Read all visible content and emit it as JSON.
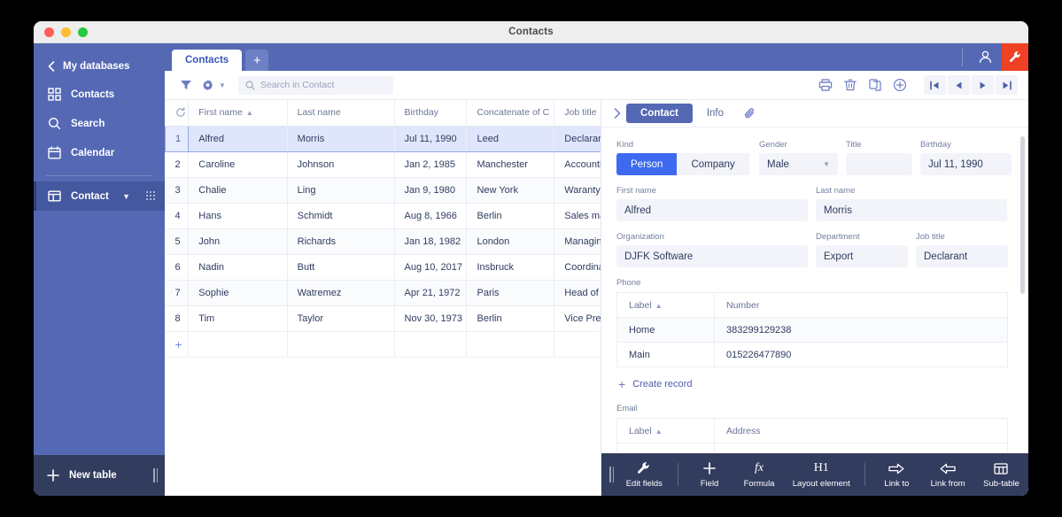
{
  "window": {
    "title": "Contacts"
  },
  "sidebar": {
    "back_label": "My databases",
    "items": [
      {
        "label": "Contacts",
        "icon": "grid-icon"
      },
      {
        "label": "Search",
        "icon": "search-icon"
      },
      {
        "label": "Calendar",
        "icon": "calendar-icon"
      }
    ],
    "active_table": {
      "label": "Contact",
      "icon": "table-icon"
    },
    "new_table_label": "New table"
  },
  "tabbar": {
    "tabs": [
      {
        "label": "Contacts"
      }
    ],
    "add_label": "+"
  },
  "toolbar": {
    "search_placeholder": "Search in Contact",
    "icons": [
      "filter-icon",
      "gear-icon",
      "chevron-down-icon"
    ],
    "right_icons": [
      "print-icon",
      "trash-icon",
      "copy-icon",
      "add-circle-icon"
    ],
    "nav_icons": [
      "first-page-icon",
      "previous-page-icon",
      "next-page-icon",
      "last-page-icon"
    ]
  },
  "table": {
    "columns": [
      "First name",
      "Last name",
      "Birthday",
      "Concatenate of C",
      "Job title"
    ],
    "sorted_column": "First name",
    "rows": [
      {
        "n": "1",
        "first": "Alfred",
        "last": "Morris",
        "birthday": "Jul 11, 1990",
        "concat": "Leed",
        "job": "Declarant"
      },
      {
        "n": "2",
        "first": "Caroline",
        "last": "Johnson",
        "birthday": "Jan 2, 1985",
        "concat": "Manchester",
        "job": "Accounting"
      },
      {
        "n": "3",
        "first": "Chalie",
        "last": "Ling",
        "birthday": "Jan 9, 1980",
        "concat": "New York",
        "job": "Waranty expert"
      },
      {
        "n": "4",
        "first": "Hans",
        "last": "Schmidt",
        "birthday": "Aug 8, 1966",
        "concat": "Berlin",
        "job": "Sales manager"
      },
      {
        "n": "5",
        "first": "John",
        "last": "Richards",
        "birthday": "Jan 18, 1982",
        "concat": "London",
        "job": "Managing director"
      },
      {
        "n": "6",
        "first": "Nadin",
        "last": "Butt",
        "birthday": "Aug 10, 2017",
        "concat": "Insbruck",
        "job": "Coordinator"
      },
      {
        "n": "7",
        "first": "Sophie",
        "last": "Watremez",
        "birthday": "Apr 21, 1972",
        "concat": "Paris",
        "job": "Head of the department"
      },
      {
        "n": "8",
        "first": "Tim",
        "last": "Taylor",
        "birthday": "Nov 30, 1973",
        "concat": "Berlin",
        "job": "Vice President"
      }
    ],
    "add_row_label": "+"
  },
  "panel": {
    "tabs": [
      {
        "label": "Contact",
        "active": true
      },
      {
        "label": "Info",
        "active": false
      }
    ],
    "attachment_icon": "paperclip-icon",
    "fields": {
      "kind": {
        "label": "Kind",
        "option_on": "Person",
        "option_off": "Company"
      },
      "gender": {
        "label": "Gender",
        "value": "Male"
      },
      "title": {
        "label": "Title",
        "value": ""
      },
      "birthday": {
        "label": "Birthday",
        "value": "Jul 11, 1990"
      },
      "first_name": {
        "label": "First name",
        "value": "Alfred"
      },
      "last_name": {
        "label": "Last name",
        "value": "Morris"
      },
      "organization": {
        "label": "Organization",
        "value": "DJFK Software"
      },
      "department": {
        "label": "Department",
        "value": "Export"
      },
      "job_title": {
        "label": "Job title",
        "value": "Declarant"
      }
    },
    "phone": {
      "label": "Phone",
      "columns": [
        "Label",
        "Number"
      ],
      "rows": [
        {
          "label": "Home",
          "number": "383299129238"
        },
        {
          "label": "Main",
          "number": "015226477890"
        }
      ],
      "create_label": "Create record"
    },
    "email": {
      "label": "Email",
      "columns": [
        "Label",
        "Address"
      ]
    },
    "bottom_bar": [
      {
        "label": "Edit fields",
        "icon": "wrench-icon"
      },
      {
        "label": "Field",
        "icon": "plus-icon"
      },
      {
        "label": "Formula",
        "icon": "formula-icon"
      },
      {
        "label": "Layout element",
        "icon": "heading-icon"
      },
      {
        "label": "Link to",
        "icon": "arrow-right-icon"
      },
      {
        "label": "Link from",
        "icon": "arrow-left-icon"
      },
      {
        "label": "Sub-table",
        "icon": "table-icon"
      }
    ]
  },
  "colors": {
    "sidebar": "#5468b4",
    "accent_blue": "#3d6af0",
    "dark_navy": "#323c5e",
    "wrench_red": "#ef4123"
  }
}
